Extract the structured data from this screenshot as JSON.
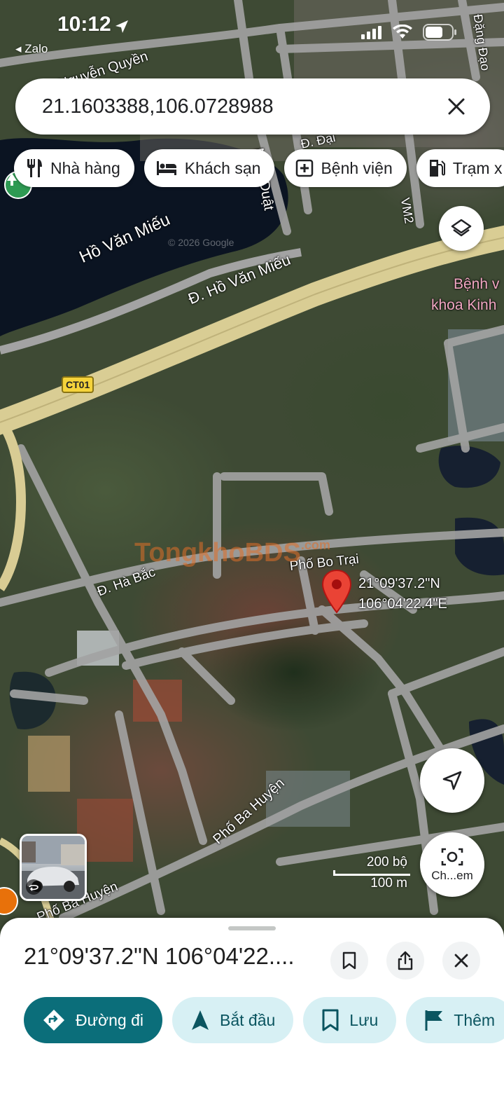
{
  "status_bar": {
    "time": "10:12",
    "back_app": "◂ Zalo"
  },
  "search": {
    "query": "21.1603388,106.0728988"
  },
  "chips": [
    {
      "label": "Nhà hàng",
      "icon": "restaurant-icon"
    },
    {
      "label": "Khách sạn",
      "icon": "hotel-icon"
    },
    {
      "label": "Bệnh viện",
      "icon": "hospital-icon"
    },
    {
      "label": "Trạm x",
      "icon": "gas-station-icon"
    }
  ],
  "map": {
    "labels": {
      "lake": "Hồ Văn Miếu",
      "road_ho_van_mieu": "Đ. Hồ Văn Miếu",
      "road_nguyen_quyen": "Nguyễn Quyền",
      "road_nhat_duat": "Nhật Duật",
      "road_ha_bac": "Đ. Hà Bắc",
      "road_pho_bo_trai": "Phố Bo Trại",
      "road_pho_ba_huyen": "Phố Ba Huyện",
      "road_pho_ba_huyen_2": "Phố Ba Huyện",
      "road_dang_dao": "Đặng Đạo",
      "road_vm2": "VM2",
      "road_d_dai": "Đ. Đại",
      "hospital_line1": "Bệnh v",
      "hospital_line2": "khoa Kinh",
      "shield_ct01": "CT01",
      "copyright": "© 2026 Google",
      "watermark": "TongkhoBDS",
      "watermark_com": ".com"
    },
    "pin": {
      "lat": "21°09'37.2\"N",
      "lng": "106°04'22.4\"E"
    },
    "scale": {
      "top": "200 bộ",
      "bottom": "100 m"
    },
    "camera_label": "Ch...em"
  },
  "sheet": {
    "title": "21°09'37.2\"N 106°04'22....",
    "actions": [
      {
        "label": "Đường đi",
        "icon": "directions-icon"
      },
      {
        "label": "Bắt đầu",
        "icon": "navigation-icon"
      },
      {
        "label": "Lưu",
        "icon": "bookmark-icon"
      },
      {
        "label": "Thêm",
        "icon": "flag-icon"
      }
    ]
  },
  "colors": {
    "accent": "#0b6e7a",
    "accent_light": "#d7f0f4",
    "pin": "#ea4335",
    "road": "#9a9a9a",
    "highway": "#d8cc94"
  }
}
